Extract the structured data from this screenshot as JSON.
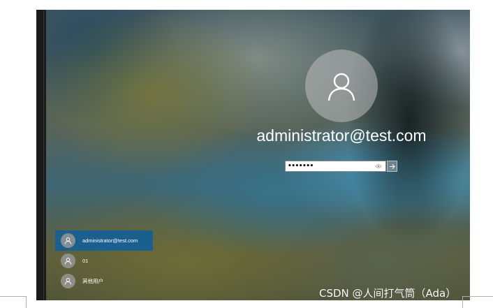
{
  "lock_screen": {
    "current_user": "administrator@test.com",
    "password_value": "•••••••",
    "reveal_icon": "eye-icon",
    "submit_icon": "arrow-right-icon",
    "avatar_icon": "person-icon"
  },
  "user_list": {
    "items": [
      {
        "label": "administrator@test.com",
        "selected": true
      },
      {
        "label": "01",
        "selected": false
      },
      {
        "label": "其他用户",
        "selected": false
      }
    ]
  },
  "watermark": {
    "text": "CSDN @人间打气筒（Ada）"
  },
  "colors": {
    "selected_user_bg": "#1b5f8e",
    "sidebar_strip": "#1b1b1b"
  }
}
